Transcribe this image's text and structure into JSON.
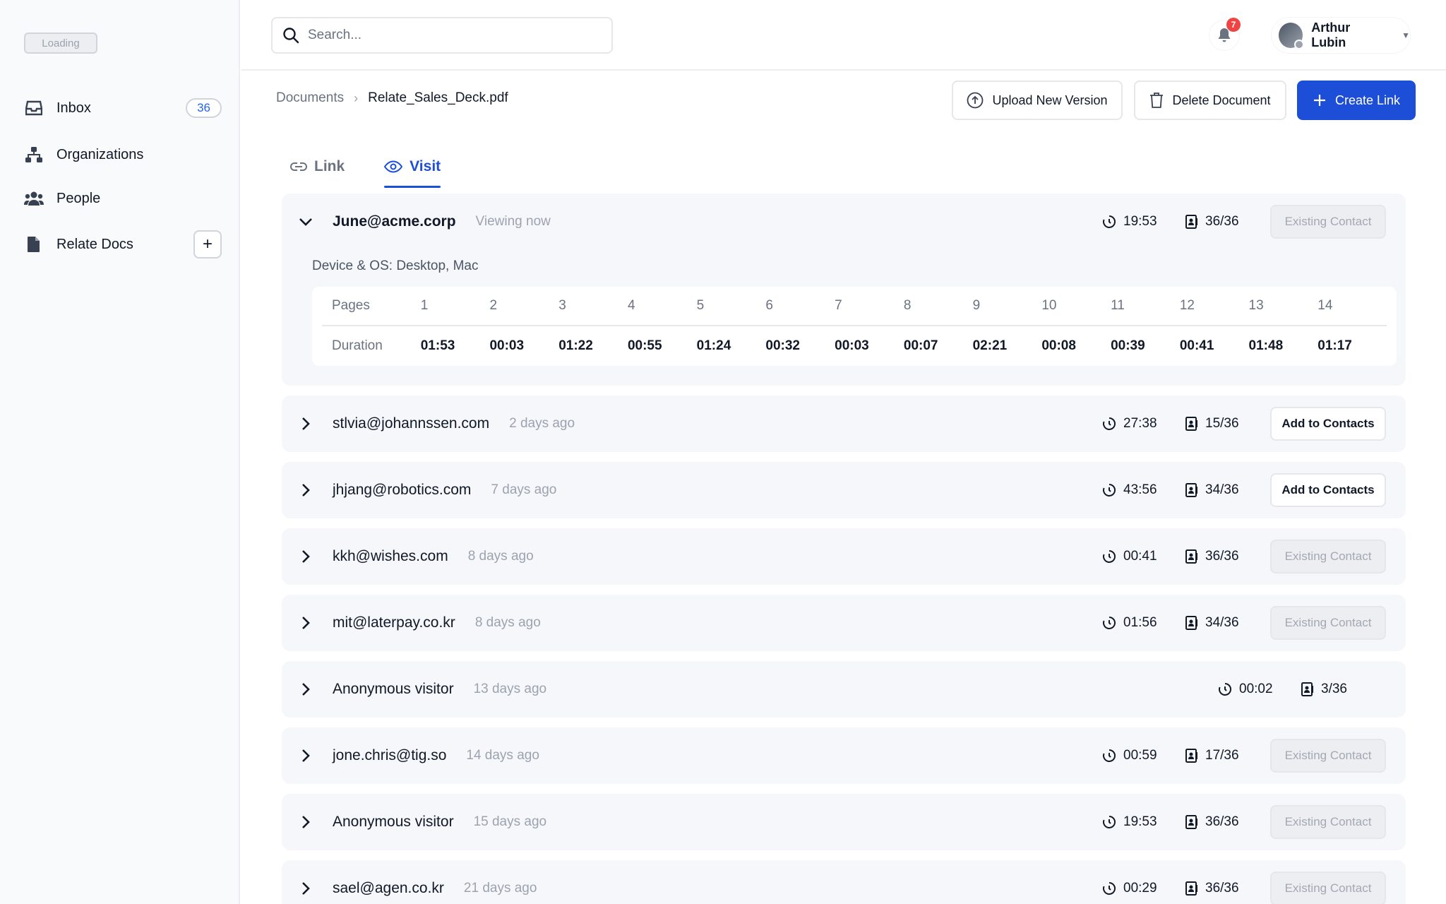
{
  "sidebar": {
    "logo_text": "Loading",
    "items": [
      {
        "label": "Inbox",
        "badge": "36"
      },
      {
        "label": "Organizations"
      },
      {
        "label": "People"
      },
      {
        "label": "Relate Docs"
      }
    ],
    "relate_docs_add": "+"
  },
  "topbar": {
    "search_placeholder": "Search...",
    "notifications_count": "7",
    "user_name": "Arthur Lubin"
  },
  "breadcrumb": {
    "parent": "Documents",
    "separator": "›",
    "current": "Relate_Sales_Deck.pdf"
  },
  "actions": {
    "upload": "Upload New Version",
    "delete": "Delete Document",
    "create": "Create Link"
  },
  "tabs": [
    {
      "label": "Link",
      "active": false
    },
    {
      "label": "Visit",
      "active": true
    }
  ],
  "expanded_visit": {
    "email": "June@acme.corp",
    "when": "Viewing now",
    "time": "19:53",
    "pages": "36/36",
    "contact_label": "Existing Contact",
    "device": "Device & OS: Desktop, Mac",
    "pages_label": "Pages",
    "duration_label": "Duration",
    "page_numbers": [
      "1",
      "2",
      "3",
      "4",
      "5",
      "6",
      "7",
      "8",
      "9",
      "10",
      "11",
      "12",
      "13",
      "14"
    ],
    "durations": [
      "01:53",
      "00:03",
      "01:22",
      "00:55",
      "01:24",
      "00:32",
      "00:03",
      "00:07",
      "02:21",
      "00:08",
      "00:39",
      "00:41",
      "01:48",
      "01:17"
    ]
  },
  "visits": [
    {
      "email": "stlvia@johannssen.com",
      "when": "2 days ago",
      "time": "27:38",
      "pages": "15/36",
      "contact": "Add to Contacts",
      "kind": "add"
    },
    {
      "email": "jhjang@robotics.com",
      "when": "7 days ago",
      "time": "43:56",
      "pages": "34/36",
      "contact": "Add to Contacts",
      "kind": "add"
    },
    {
      "email": "kkh@wishes.com",
      "when": "8 days ago",
      "time": "00:41",
      "pages": "36/36",
      "contact": "Existing Contact",
      "kind": "existing"
    },
    {
      "email": "mit@laterpay.co.kr",
      "when": "8 days ago",
      "time": "01:56",
      "pages": "34/36",
      "contact": "Existing Contact",
      "kind": "existing"
    },
    {
      "email": "Anonymous visitor",
      "when": "13 days ago",
      "time": "00:02",
      "pages": "3/36",
      "contact": "",
      "kind": "none"
    },
    {
      "email": "jone.chris@tig.so",
      "when": "14 days ago",
      "time": "00:59",
      "pages": "17/36",
      "contact": "Existing Contact",
      "kind": "existing"
    },
    {
      "email": "Anonymous visitor",
      "when": "15 days ago",
      "time": "19:53",
      "pages": "36/36",
      "contact": "Existing Contact",
      "kind": "existing"
    },
    {
      "email": "sael@agen.co.kr",
      "when": "21 days ago",
      "time": "00:29",
      "pages": "36/36",
      "contact": "Existing Contact",
      "kind": "existing"
    }
  ],
  "colors": {
    "accent": "#1d4ed8",
    "row_bg": "#f5f7fb",
    "badge_red": "#ef4444"
  }
}
